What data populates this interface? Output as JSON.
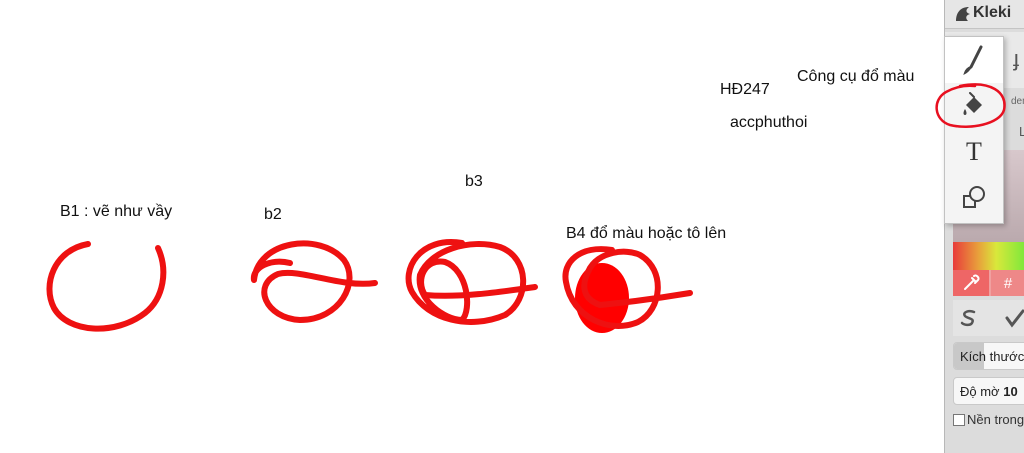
{
  "app": {
    "title": "Kleki"
  },
  "captions": {
    "b1": "B1 : vẽ như vầy",
    "b2": "b2",
    "b3": "b3",
    "b4": "B4 đổ màu hoặc tô lên",
    "watermark": "HĐ247",
    "fill_tool_note": "Công cụ đổ  màu",
    "author": "accphuthoi"
  },
  "tools": [
    {
      "name": "brush",
      "icon": "brush-icon",
      "selected": true
    },
    {
      "name": "paint-bucket",
      "icon": "paint-bucket-icon",
      "selected": false
    },
    {
      "name": "text",
      "icon": "text-icon",
      "glyph": "T",
      "selected": false
    },
    {
      "name": "shape",
      "icon": "shape-icon",
      "selected": false
    }
  ],
  "panel": {
    "partial_density_label": "dens",
    "partial_letter": "L",
    "hex_label": "#",
    "size_label": "Kích thước",
    "size_fraction": 0.38,
    "opacity_label": "Độ mờ",
    "opacity_value": "10",
    "opacity_fraction": 0.0,
    "transparent_bg_label": "Nền trong"
  },
  "colors": {
    "stroke": "#ee1111",
    "fill": "#ff0000",
    "highlight": "#e81020",
    "panel_bg": "#dcdcdc"
  }
}
